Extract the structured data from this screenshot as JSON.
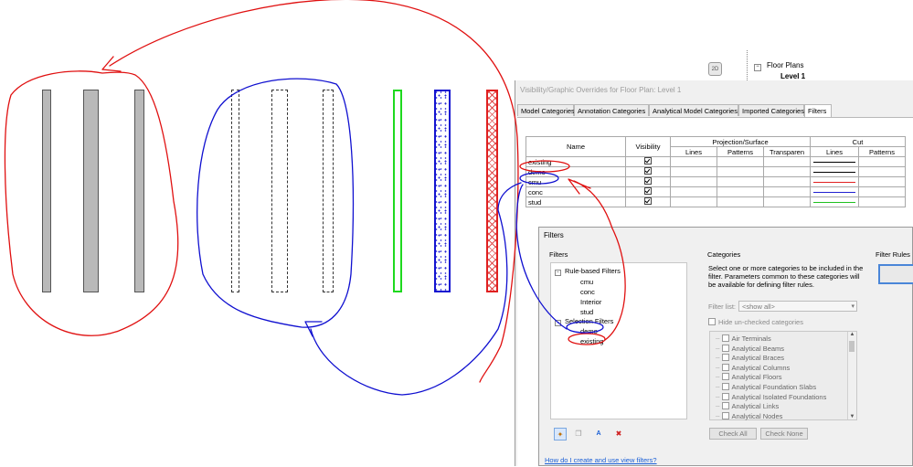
{
  "project_browser": {
    "floor_plans": "Floor Plans",
    "level": "Level 1"
  },
  "vg_dialog": {
    "title": "Visibility/Graphic Overrides for Floor Plan: Level 1",
    "tabs": [
      "Model Categories",
      "Annotation Categories",
      "Analytical Model Categories",
      "Imported Categories",
      "Filters"
    ],
    "active_tab": "Filters",
    "headers": {
      "name": "Name",
      "visibility": "Visibility",
      "projection": "Projection/Surface",
      "cut": "Cut",
      "lines": "Lines",
      "patterns": "Patterns",
      "transparency": "Transparen",
      "cut_lines": "Lines",
      "cut_patterns": "Patterns"
    },
    "rows": [
      {
        "name": "existing",
        "visible": true,
        "cut_line_color": "#000000"
      },
      {
        "name": "demo",
        "visible": true,
        "cut_line_color": "#000000"
      },
      {
        "name": "cmu",
        "visible": true,
        "cut_line_color": "#e02020"
      },
      {
        "name": "conc",
        "visible": true,
        "cut_line_color": "#2020d0"
      },
      {
        "name": "stud",
        "visible": true,
        "cut_line_color": "#20c020"
      }
    ]
  },
  "filters_dialog": {
    "title": "Filters",
    "filters_label": "Filters",
    "categories_label": "Categories",
    "filter_rules_label": "Filter Rules",
    "rule_based": "Rule-based Filters",
    "rule_items": [
      "cmu",
      "conc",
      "Interior",
      "stud"
    ],
    "selection_filters": "Selection Filters",
    "selection_items": [
      "demo",
      "existing"
    ],
    "categories_desc": "Select one or more categories to be included in the filter.  Parameters common to these categories will be available for defining filter rules.",
    "filter_list_label": "Filter list:",
    "filter_list_value": "<show all>",
    "hide_unchecked": "Hide un-checked categories",
    "categories": [
      "Air Terminals",
      "Analytical Beams",
      "Analytical Braces",
      "Analytical Columns",
      "Analytical Floors",
      "Analytical Foundation Slabs",
      "Analytical Isolated Foundations",
      "Analytical Links",
      "Analytical Nodes"
    ],
    "check_all": "Check All",
    "check_none": "Check None",
    "help_link": "How do I create and use view filters?"
  },
  "colors": {
    "annotation_red": "#e01010",
    "annotation_blue": "#1010d0",
    "link_blue": "#1a5fd6"
  }
}
